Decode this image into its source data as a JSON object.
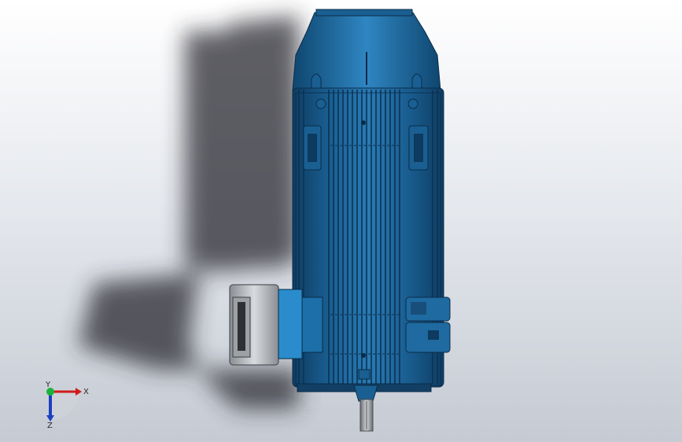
{
  "viewport": {
    "background_top": "#ffffff",
    "background_bottom": "#c5cad3",
    "model_color": "#1f6aa0",
    "model_dark": "#0f3f68",
    "junction_box_color": "#c0c4c8"
  },
  "triad": {
    "x_label": "X",
    "y_label": "Y",
    "z_label": "Z",
    "x_color": "#d11b1b",
    "y_color": "#1ab33a",
    "z_color": "#1d3fbf"
  }
}
